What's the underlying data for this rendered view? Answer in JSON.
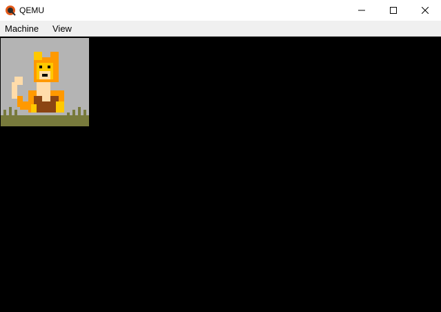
{
  "window": {
    "title": "QEMU",
    "app_icon": "qemu-logo-icon",
    "controls": [
      "minimize-icon",
      "maximize-icon",
      "close-icon"
    ]
  },
  "menu": {
    "items": [
      {
        "label": "Machine"
      },
      {
        "label": "View"
      }
    ]
  },
  "display": {
    "background": "#000000",
    "image": "pixel-art-fox-sitting-on-grass"
  },
  "colors": {
    "fox_orange": "#ff9900",
    "fox_yellow": "#ffc800",
    "fox_brown": "#8b4513",
    "fox_cream": "#ffdcaa",
    "grass": "#787a3c",
    "sky_gray": "#b4b4b4"
  }
}
